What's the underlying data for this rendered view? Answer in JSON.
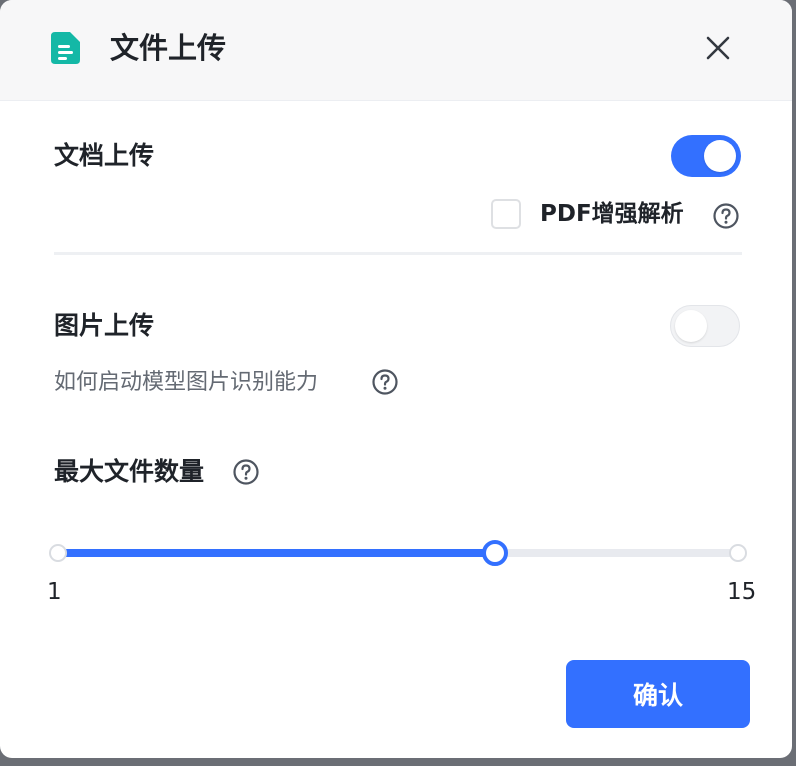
{
  "dialog": {
    "title": "文件上传",
    "title_icon": "document-icon",
    "close_icon": "close-icon"
  },
  "document_upload": {
    "label": "文档上传",
    "enabled": true,
    "pdf_enhance": {
      "label": "PDF增强解析",
      "checked": false
    }
  },
  "image_upload": {
    "label": "图片上传",
    "enabled": false,
    "hint": "如何启动模型图片识别能力"
  },
  "max_files": {
    "label": "最大文件数量",
    "min": 1,
    "max": 15,
    "value": 10,
    "min_label": "1",
    "max_label": "15"
  },
  "footer": {
    "confirm_label": "确认"
  },
  "colors": {
    "accent": "#3370ff",
    "icon_teal": "#14b8a6",
    "text_primary": "#1f2329",
    "text_secondary": "#646a73"
  }
}
